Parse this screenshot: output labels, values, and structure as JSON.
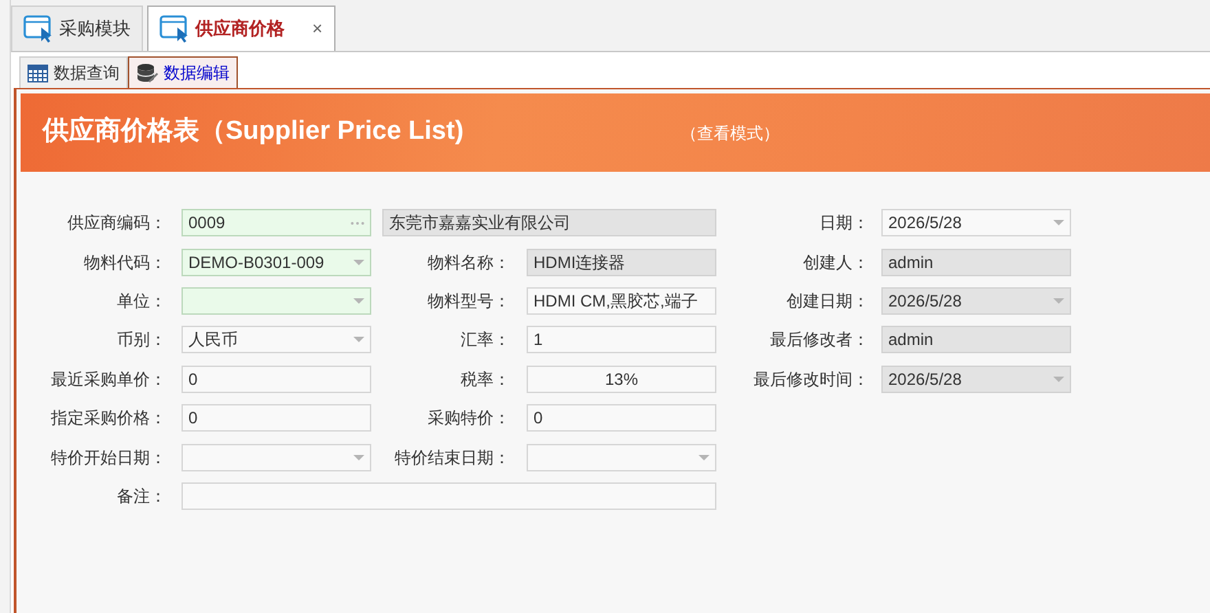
{
  "top_tabs": [
    {
      "label": "采购模块",
      "selected": false
    },
    {
      "label": "供应商价格",
      "selected": true,
      "close": "×"
    }
  ],
  "sub_tabs": [
    {
      "label": "数据查询",
      "selected": false,
      "kind": "grid"
    },
    {
      "label": "数据编辑",
      "selected": true,
      "kind": "database"
    }
  ],
  "header": {
    "title": "供应商价格表（Supplier Price List)",
    "mode": "（查看模式）"
  },
  "form_rows": [
    {
      "items": [
        {
          "label": "供应商编码：",
          "value": "0009",
          "kind": "lookup",
          "required": true,
          "readonly": false
        },
        {
          "value": "东莞市嘉嘉实业有限公司",
          "kind": "text",
          "required": false,
          "readonly": true
        }
      ]
    },
    {
      "items": [
        {
          "label": "物料代码：",
          "value": "DEMO-B0301-009",
          "kind": "dropdown",
          "required": true,
          "readonly": false
        },
        {
          "label": "物料名称：",
          "value": "HDMI连接器",
          "kind": "text",
          "required": false,
          "readonly": true
        }
      ]
    },
    {
      "items": [
        {
          "label": "单位：",
          "kind": "dropdown",
          "required": true,
          "readonly": false
        },
        {
          "label": "物料型号：",
          "value": "HDMI CM,黑胶芯,端子",
          "kind": "text",
          "required": false,
          "readonly": false
        }
      ]
    },
    {
      "items": [
        {
          "label": "币别：",
          "value": "人民币",
          "kind": "dropdown",
          "required": false,
          "readonly": false
        },
        {
          "label": "汇率：",
          "value": "1",
          "kind": "text",
          "required": false,
          "readonly": false
        }
      ]
    },
    {
      "items": [
        {
          "label": "最近采购单价：",
          "value": "0",
          "kind": "text",
          "required": false,
          "readonly": false
        },
        {
          "label": "税率：",
          "value": "13%",
          "kind": "text",
          "required": false,
          "readonly": false,
          "centered": true
        }
      ]
    },
    {
      "items": [
        {
          "label": "指定采购价格：",
          "value": "0",
          "kind": "text",
          "required": false,
          "readonly": false
        },
        {
          "label": "采购特价：",
          "value": "0",
          "kind": "text",
          "required": false,
          "readonly": false
        }
      ]
    },
    {
      "items": [
        {
          "label": "特价开始日期：",
          "kind": "dropdown",
          "required": false,
          "readonly": false
        },
        {
          "label": "特价结束日期：",
          "kind": "dropdown",
          "required": false,
          "readonly": false
        }
      ]
    },
    {
      "items": [
        {
          "label": "备注：",
          "kind": "text",
          "required": false,
          "readonly": false
        }
      ]
    }
  ],
  "side_fields": [
    {
      "label": "日期：",
      "value": "2026/5/28",
      "kind": "dropdown",
      "required": false,
      "readonly": false
    },
    {
      "label": "创建人：",
      "value": "admin",
      "kind": "text",
      "required": false,
      "readonly": true
    },
    {
      "label": "创建日期：",
      "value": "2026/5/28",
      "kind": "dropdown",
      "required": false,
      "readonly": true
    },
    {
      "label": "最后修改者：",
      "value": "admin",
      "kind": "text",
      "required": false,
      "readonly": true
    },
    {
      "label": "最后修改时间：",
      "value": "2026/5/28",
      "kind": "dropdown",
      "required": false,
      "readonly": true
    }
  ]
}
